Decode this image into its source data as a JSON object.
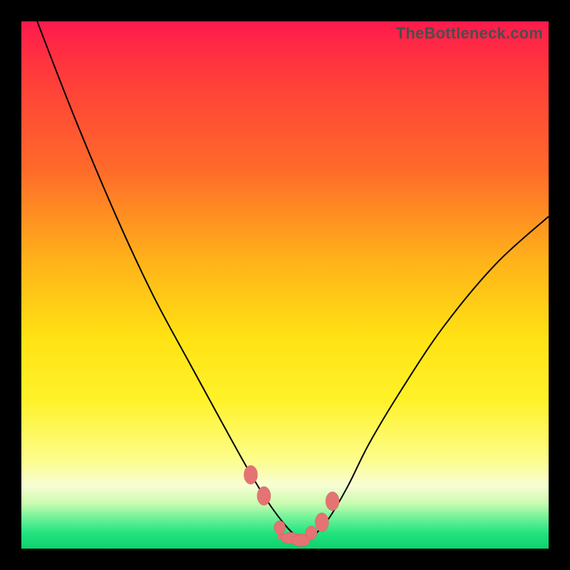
{
  "watermark": "TheBottleneck.com",
  "colors": {
    "frame": "#000000",
    "curve": "#000000",
    "marker": "#e57373",
    "gradient_top": "#ff1a4d",
    "gradient_bottom": "#0ed16e"
  },
  "chart_data": {
    "type": "line",
    "title": "",
    "xlabel": "",
    "ylabel": "",
    "xlim": [
      0,
      100
    ],
    "ylim": [
      0,
      100
    ],
    "series": [
      {
        "name": "left-curve",
        "x": [
          3,
          10,
          18,
          25,
          32,
          38,
          43,
          47,
          50,
          52,
          54
        ],
        "y": [
          100,
          82,
          63,
          48,
          35,
          24,
          15,
          8.5,
          4.5,
          2.5,
          1.5
        ]
      },
      {
        "name": "right-curve",
        "x": [
          54,
          56,
          58.5,
          62,
          66,
          72,
          80,
          90,
          100
        ],
        "y": [
          1.5,
          3,
          6,
          12,
          20,
          30,
          42,
          54,
          63
        ]
      }
    ],
    "markers": {
      "name": "highlighted-points",
      "x": [
        43.5,
        46,
        49,
        51,
        53,
        55,
        57,
        59
      ],
      "y": [
        14,
        10,
        4,
        2,
        1.5,
        3,
        5,
        9
      ],
      "rx": [
        1.3,
        1.3,
        1.1,
        1.8,
        1.8,
        1.1,
        1.3,
        1.3
      ],
      "ry": [
        1.8,
        1.8,
        1.3,
        1.1,
        1.1,
        1.3,
        1.8,
        1.8
      ]
    },
    "trough_segment": {
      "x": [
        49,
        55
      ],
      "y": [
        2.3,
        2.3
      ]
    }
  }
}
